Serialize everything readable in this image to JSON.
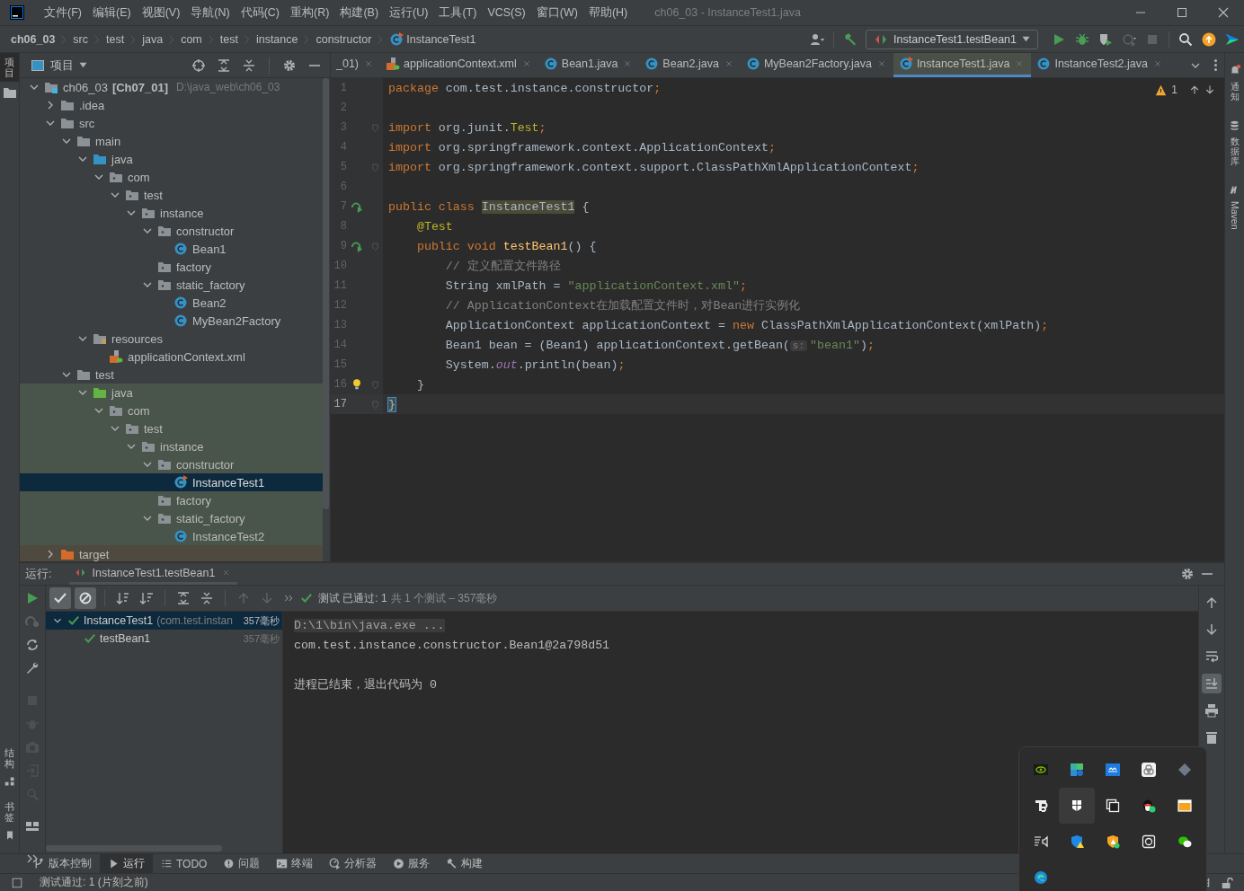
{
  "window": {
    "title": "ch06_03 - InstanceTest1.java"
  },
  "menu": [
    "文件(F)",
    "编辑(E)",
    "视图(V)",
    "导航(N)",
    "代码(C)",
    "重构(R)",
    "构建(B)",
    "运行(U)",
    "工具(T)",
    "VCS(S)",
    "窗口(W)",
    "帮助(H)"
  ],
  "breadcrumbs": [
    {
      "label": "ch06_03",
      "kind": "project"
    },
    {
      "label": "src",
      "kind": "dir"
    },
    {
      "label": "test",
      "kind": "dir"
    },
    {
      "label": "java",
      "kind": "dir"
    },
    {
      "label": "com",
      "kind": "dir"
    },
    {
      "label": "test",
      "kind": "dir"
    },
    {
      "label": "instance",
      "kind": "dir"
    },
    {
      "label": "constructor",
      "kind": "dir"
    },
    {
      "label": "InstanceTest1",
      "kind": "class"
    }
  ],
  "run_config": {
    "label": "InstanceTest1.testBean1"
  },
  "left_strip": {
    "top": [
      {
        "label": "项目",
        "selected": true
      }
    ],
    "bottom": [
      {
        "label": "结构",
        "selected": false
      },
      {
        "label": "书签",
        "selected": false
      }
    ]
  },
  "right_strip": [
    {
      "label": "通知",
      "kind": "cjk"
    },
    {
      "label": "数据库",
      "kind": "cjk"
    },
    {
      "label": "Maven",
      "kind": "latin"
    }
  ],
  "project": {
    "title": "项目",
    "tree": [
      {
        "name": "ch06_03",
        "module": "[Ch07_01]",
        "path": "D:\\java_web\\ch06_03",
        "kind": "module",
        "expanded": true,
        "selected": false,
        "children": [
          {
            "name": ".idea",
            "kind": "folder",
            "expanded": false,
            "selected": false
          },
          {
            "name": "src",
            "kind": "folder",
            "expanded": true,
            "selected": false,
            "children": [
              {
                "name": "main",
                "kind": "folder",
                "expanded": true,
                "selected": false,
                "children": [
                  {
                    "name": "java",
                    "kind": "source",
                    "expanded": true,
                    "selected": false,
                    "children": [
                      {
                        "name": "com",
                        "kind": "package",
                        "expanded": true,
                        "selected": false,
                        "children": [
                          {
                            "name": "test",
                            "kind": "package",
                            "expanded": true,
                            "selected": false,
                            "children": [
                              {
                                "name": "instance",
                                "kind": "package",
                                "expanded": true,
                                "selected": false,
                                "children": [
                                  {
                                    "name": "constructor",
                                    "kind": "package",
                                    "expanded": true,
                                    "selected": false,
                                    "children": [
                                      {
                                        "name": "Bean1",
                                        "kind": "class",
                                        "selected": false
                                      }
                                    ]
                                  },
                                  {
                                    "name": "factory",
                                    "kind": "package",
                                    "selected": false
                                  },
                                  {
                                    "name": "static_factory",
                                    "kind": "package",
                                    "expanded": true,
                                    "selected": false,
                                    "children": [
                                      {
                                        "name": "Bean2",
                                        "kind": "class",
                                        "selected": false
                                      },
                                      {
                                        "name": "MyBean2Factory",
                                        "kind": "class",
                                        "selected": false
                                      }
                                    ]
                                  }
                                ]
                              }
                            ]
                          }
                        ]
                      }
                    ]
                  },
                  {
                    "name": "resources",
                    "kind": "resources",
                    "expanded": true,
                    "selected": false,
                    "children": [
                      {
                        "name": "applicationContext.xml",
                        "kind": "xml",
                        "selected": false
                      }
                    ]
                  }
                ]
              },
              {
                "name": "test",
                "kind": "folder",
                "expanded": true,
                "selected": false,
                "children": [
                  {
                    "name": "java",
                    "kind": "test_source",
                    "test_scope": true,
                    "expanded": true,
                    "selected": false,
                    "children": [
                      {
                        "name": "com",
                        "kind": "package",
                        "expanded": true,
                        "selected": false,
                        "children": [
                          {
                            "name": "test",
                            "kind": "package",
                            "expanded": true,
                            "selected": false,
                            "children": [
                              {
                                "name": "instance",
                                "kind": "package",
                                "expanded": true,
                                "selected": false,
                                "children": [
                                  {
                                    "name": "constructor",
                                    "kind": "package",
                                    "expanded": true,
                                    "selected": false,
                                    "children": [
                                      {
                                        "name": "InstanceTest1",
                                        "kind": "class_run",
                                        "selected": true
                                      }
                                    ]
                                  },
                                  {
                                    "name": "factory",
                                    "kind": "package",
                                    "selected": false
                                  },
                                  {
                                    "name": "static_factory",
                                    "kind": "package",
                                    "expanded": true,
                                    "selected": false,
                                    "children": [
                                      {
                                        "name": "InstanceTest2",
                                        "kind": "class",
                                        "selected": false
                                      }
                                    ]
                                  }
                                ]
                              }
                            ]
                          }
                        ]
                      }
                    ]
                  }
                ]
              }
            ]
          },
          {
            "name": "target",
            "kind": "excluded",
            "expanded": false,
            "selected": false
          }
        ]
      }
    ]
  },
  "editor": {
    "tabs": [
      {
        "label": "_01)",
        "kind": "cut",
        "selected": false
      },
      {
        "label": "applicationContext.xml",
        "kind": "xml",
        "selected": false
      },
      {
        "label": "Bean1.java",
        "kind": "class",
        "selected": false
      },
      {
        "label": "Bean2.java",
        "kind": "class",
        "selected": false
      },
      {
        "label": "MyBean2Factory.java",
        "kind": "class",
        "selected": false
      },
      {
        "label": "InstanceTest1.java",
        "kind": "class_run",
        "selected": true
      },
      {
        "label": "InstanceTest2.java",
        "kind": "class",
        "selected": false
      }
    ],
    "warnings": "1",
    "lines": [
      {
        "n": "1",
        "kind": "plain",
        "fold": false,
        "current": false,
        "tokens": [
          {
            "t": "package ",
            "kind": "kw"
          },
          {
            "t": "com.test.instance.constructor",
            "kind": "plain"
          },
          {
            "t": ";",
            "kind": "kw"
          }
        ]
      },
      {
        "n": "2",
        "kind": "plain",
        "fold": false,
        "current": false
      },
      {
        "n": "3",
        "kind": "plain",
        "fold": true,
        "current": false,
        "tokens": [
          {
            "t": "import ",
            "kind": "kw"
          },
          {
            "t": "org.junit.",
            "kind": "plain"
          },
          {
            "t": "Test",
            "kind": "ann"
          },
          {
            "t": ";",
            "kind": "kw"
          }
        ]
      },
      {
        "n": "4",
        "kind": "plain",
        "fold": false,
        "current": false,
        "tokens": [
          {
            "t": "import ",
            "kind": "kw"
          },
          {
            "t": "org.springframework.context.ApplicationContext",
            "kind": "plain"
          },
          {
            "t": ";",
            "kind": "kw"
          }
        ]
      },
      {
        "n": "5",
        "kind": "plain",
        "fold": true,
        "current": false,
        "tokens": [
          {
            "t": "import ",
            "kind": "kw"
          },
          {
            "t": "org.springframework.context.support.ClassPathXmlApplicationContext",
            "kind": "plain"
          },
          {
            "t": ";",
            "kind": "kw"
          }
        ]
      },
      {
        "n": "6",
        "kind": "plain",
        "fold": false,
        "current": false
      },
      {
        "n": "7",
        "kind": "run",
        "fold": false,
        "current": false,
        "tokens": [
          {
            "t": "public class ",
            "kind": "kw"
          },
          {
            "t": "InstanceTest1",
            "kind": "hl"
          },
          {
            "t": " {",
            "kind": "plain"
          }
        ]
      },
      {
        "n": "8",
        "kind": "plain",
        "fold": false,
        "current": false,
        "tokens": [
          {
            "t": "    @Test",
            "kind": "ann"
          }
        ]
      },
      {
        "n": "9",
        "kind": "run",
        "fold": true,
        "current": false,
        "tokens": [
          {
            "t": "    public void ",
            "kind": "kw"
          },
          {
            "t": "testBean1",
            "kind": "fn"
          },
          {
            "t": "() {",
            "kind": "plain"
          }
        ]
      },
      {
        "n": "10",
        "kind": "plain",
        "fold": false,
        "current": false,
        "tokens": [
          {
            "t": "        // 定义配置文件路径",
            "kind": "cmt"
          }
        ]
      },
      {
        "n": "11",
        "kind": "plain",
        "fold": false,
        "current": false,
        "tokens": [
          {
            "t": "        String xmlPath = ",
            "kind": "plain"
          },
          {
            "t": "\"applicationContext.xml\"",
            "kind": "str"
          },
          {
            "t": ";",
            "kind": "kw"
          }
        ]
      },
      {
        "n": "12",
        "kind": "plain",
        "fold": false,
        "current": false,
        "tokens": [
          {
            "t": "        // ApplicationContext在加载配置文件时，对Bean进行实例化",
            "kind": "cmt"
          }
        ]
      },
      {
        "n": "13",
        "kind": "plain",
        "fold": false,
        "current": false,
        "tokens": [
          {
            "t": "        ApplicationContext applicationContext = ",
            "kind": "plain"
          },
          {
            "t": "new ",
            "kind": "kw"
          },
          {
            "t": "ClassPathXmlApplicationContext(xmlPath)",
            "kind": "plain"
          },
          {
            "t": ";",
            "kind": "kw"
          }
        ]
      },
      {
        "n": "14",
        "kind": "plain",
        "fold": false,
        "current": false,
        "tokens": [
          {
            "t": "        Bean1 bean = (Bean1) applicationContext.getBean(",
            "kind": "plain"
          },
          {
            "t": "s:",
            "kind": "hint"
          },
          {
            "t": "\"bean1\"",
            "kind": "str"
          },
          {
            "t": ")",
            "kind": "plain"
          },
          {
            "t": ";",
            "kind": "kw"
          }
        ]
      },
      {
        "n": "15",
        "kind": "plain",
        "fold": false,
        "current": false,
        "tokens": [
          {
            "t": "        System.",
            "kind": "plain"
          },
          {
            "t": "out",
            "kind": "ital"
          },
          {
            "t": ".println(bean)",
            "kind": "plain"
          },
          {
            "t": ";",
            "kind": "kw"
          }
        ]
      },
      {
        "n": "16",
        "kind": "bulb",
        "fold": true,
        "current": false,
        "tokens": [
          {
            "t": "    }",
            "kind": "plain"
          }
        ]
      },
      {
        "n": "17",
        "kind": "plain",
        "fold": true,
        "current": true,
        "tokens": [
          {
            "t": "}",
            "kind": "match"
          }
        ]
      }
    ]
  },
  "run": {
    "label": "运行:",
    "tab": "InstanceTest1.testBean1",
    "summary": "测试 已通过: 1",
    "summary_detail": "共 1 个测试 – 357毫秒",
    "toggles": [
      {
        "kind": "passed",
        "on": true
      },
      {
        "kind": "ignored",
        "on": true
      }
    ],
    "tests": [
      {
        "name": "InstanceTest1",
        "detail": "(com.test.instan",
        "time": "357毫秒",
        "passed": true,
        "expanded": true,
        "selected": true,
        "children": [
          {
            "name": "testBean1",
            "time": "357毫秒",
            "passed": true,
            "selected": false
          }
        ]
      }
    ],
    "console": [
      {
        "kind": "folded",
        "text": "D:\\1\\bin\\java.exe ..."
      },
      {
        "kind": "out",
        "text": "com.test.instance.constructor.Bean1@2a798d51"
      },
      {
        "kind": "blank"
      },
      {
        "kind": "out",
        "text": "进程已结束，退出代码为 0"
      }
    ],
    "console_tools": [
      {
        "kind": "up",
        "on": false
      },
      {
        "kind": "down",
        "on": false
      },
      {
        "kind": "wrap",
        "on": false
      },
      {
        "kind": "scroll_end",
        "on": true
      },
      {
        "kind": "print",
        "on": false
      },
      {
        "kind": "trash",
        "on": false
      }
    ]
  },
  "tool_tabs": [
    {
      "label": "版本控制",
      "kind": "vcs",
      "selected": false
    },
    {
      "label": "运行",
      "kind": "run",
      "selected": true
    },
    {
      "label": "TODO",
      "kind": "todo",
      "selected": false
    },
    {
      "label": "问题",
      "kind": "problems",
      "selected": false
    },
    {
      "label": "终端",
      "kind": "terminal",
      "selected": false
    },
    {
      "label": "分析器",
      "kind": "profiler",
      "selected": false
    },
    {
      "label": "服务",
      "kind": "services",
      "selected": false
    },
    {
      "label": "构建",
      "kind": "build",
      "selected": false
    }
  ],
  "status": {
    "text": "测试通过: 1 (片刻之前)"
  },
  "tray": [
    {
      "kind": "nvidia",
      "selected": false
    },
    {
      "kind": "tiles",
      "selected": false
    },
    {
      "kind": "cloud",
      "selected": false
    },
    {
      "kind": "rings",
      "selected": false
    },
    {
      "kind": "diamond",
      "selected": false
    },
    {
      "kind": "tb",
      "selected": false
    },
    {
      "kind": "bookmark",
      "selected": true
    },
    {
      "kind": "copy",
      "selected": false
    },
    {
      "kind": "penguin",
      "selected": false
    },
    {
      "kind": "window",
      "selected": false
    },
    {
      "kind": "list",
      "selected": false
    },
    {
      "kind": "shield",
      "selected": false
    },
    {
      "kind": "shield_orange",
      "selected": false
    },
    {
      "kind": "camera",
      "selected": false
    },
    {
      "kind": "chat",
      "selected": false
    },
    {
      "kind": "edge",
      "selected": false
    }
  ]
}
